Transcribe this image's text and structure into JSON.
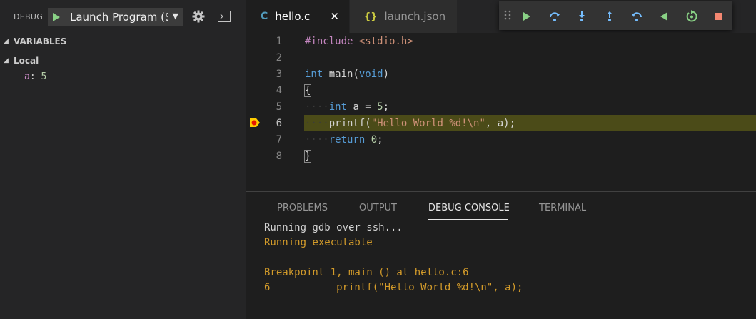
{
  "debug_toolbar": {
    "label": "DEBUG",
    "launch_config": "Launch Program (SSH)",
    "icons": [
      "play-icon",
      "gear-icon",
      "terminal-icon"
    ]
  },
  "variables": {
    "header": "VARIABLES",
    "scope": "Local",
    "items": [
      {
        "name": "a",
        "value": "5"
      }
    ]
  },
  "tabs": [
    {
      "icon": "C",
      "label": "hello.c",
      "active": true
    },
    {
      "icon": "{}",
      "label": "launch.json",
      "active": false
    }
  ],
  "debug_controls": [
    "continue-icon",
    "step-over-icon",
    "step-into-icon",
    "step-out-icon",
    "step-back-icon",
    "reverse-continue-icon",
    "restart-icon",
    "stop-icon"
  ],
  "editor": {
    "lines": [
      {
        "n": "1",
        "text": "#include <stdio.h>"
      },
      {
        "n": "2",
        "text": ""
      },
      {
        "n": "3",
        "text": "int main(void)"
      },
      {
        "n": "4",
        "text": "{"
      },
      {
        "n": "5",
        "text": "    int a = 5;"
      },
      {
        "n": "6",
        "text": "    printf(\"Hello World %d!\\n\", a);"
      },
      {
        "n": "7",
        "text": "    return 0;"
      },
      {
        "n": "8",
        "text": "}"
      }
    ],
    "current_line": 6
  },
  "panel": {
    "tabs": [
      "PROBLEMS",
      "OUTPUT",
      "DEBUG CONSOLE",
      "TERMINAL"
    ],
    "active_tab": "DEBUG CONSOLE",
    "console": [
      "Running gdb over ssh...",
      "Running executable",
      "",
      "Breakpoint 1, main () at hello.c:6",
      "6           printf(\"Hello World %d!\\n\", a);"
    ]
  },
  "colors": {
    "accent_green": "#89d185",
    "accent_blue": "#75beff",
    "stop_red": "#f48771",
    "current_line": "#4b4b18",
    "console_warn": "#d39b2a"
  }
}
